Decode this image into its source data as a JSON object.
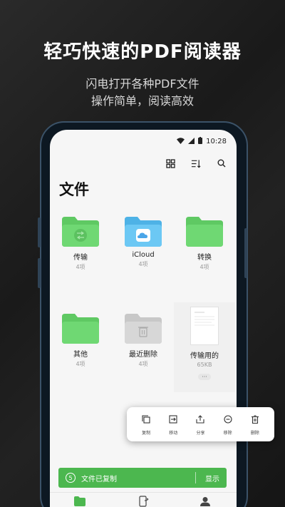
{
  "promo": {
    "headline": "轻巧快速的PDF阅读器",
    "subline1": "闪电打开各种PDF文件",
    "subline2": "操作简单，阅读高效"
  },
  "status_bar": {
    "time": "10:28"
  },
  "page": {
    "title": "文件"
  },
  "toolbar": {
    "icons": [
      "grid-view-icon",
      "sort-icon",
      "search-icon"
    ]
  },
  "items": [
    {
      "label": "传输",
      "count": "4项",
      "kind": "folder-transfer",
      "color": "#6fd873"
    },
    {
      "label": "iCloud",
      "count": "4项",
      "kind": "folder-icloud",
      "color": "#6cc8f4"
    },
    {
      "label": "转换",
      "count": "4项",
      "kind": "folder",
      "color": "#6fd873"
    },
    {
      "label": "其他",
      "count": "4项",
      "kind": "folder",
      "color": "#6fd873"
    },
    {
      "label": "最近删除",
      "count": "4项",
      "kind": "folder-trash",
      "color": "#d7d7d7"
    },
    {
      "label": "传输用的",
      "count": "65KB",
      "kind": "document",
      "more": "···"
    }
  ],
  "action_bar": {
    "actions": [
      {
        "label": "复制",
        "icon": "copy-icon"
      },
      {
        "label": "移动",
        "icon": "move-icon"
      },
      {
        "label": "分享",
        "icon": "share-icon"
      },
      {
        "label": "移除",
        "icon": "remove-icon"
      },
      {
        "label": "删除",
        "icon": "trash-icon"
      }
    ]
  },
  "toast": {
    "countdown": "5",
    "message": "文件已复制",
    "button": "显示",
    "color": "#4cb74f"
  },
  "bottom_nav": {
    "icons": [
      "files-tab-icon",
      "transfer-tab-icon",
      "profile-tab-icon"
    ],
    "active_color": "#4cb74f"
  }
}
